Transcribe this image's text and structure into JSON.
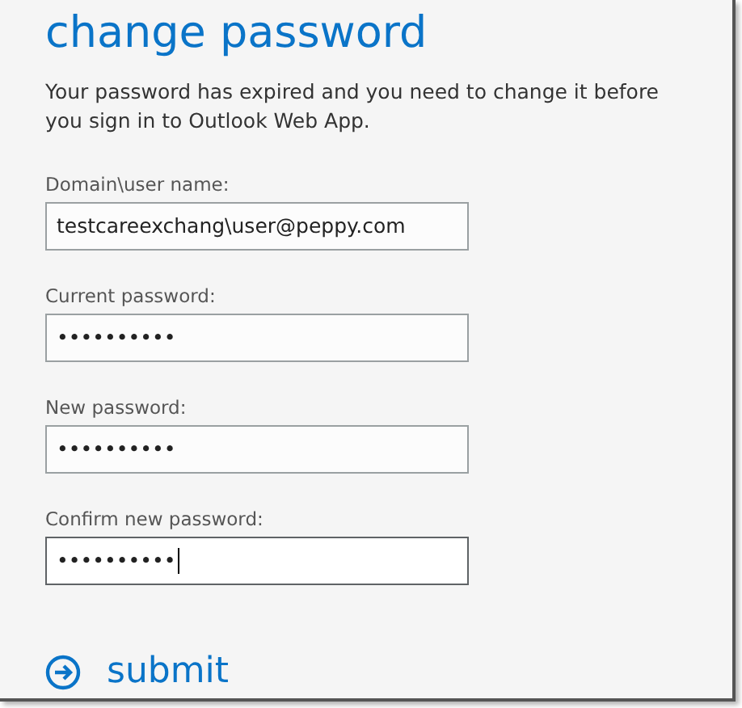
{
  "title": "change password",
  "message": "Your password has expired and you need to change it before you sign in to Outlook Web App.",
  "fields": [
    {
      "label": "Domain\\user name:",
      "value": "testcareexchang\\user@peppy.com",
      "focused": false
    },
    {
      "label": "Current password:",
      "value": "••••••••••",
      "focused": false
    },
    {
      "label": "New password:",
      "value": "••••••••••",
      "focused": false
    },
    {
      "label": "Confirm new password:",
      "value": "••••••••••",
      "focused": true
    }
  ],
  "submit": {
    "label": "submit"
  }
}
